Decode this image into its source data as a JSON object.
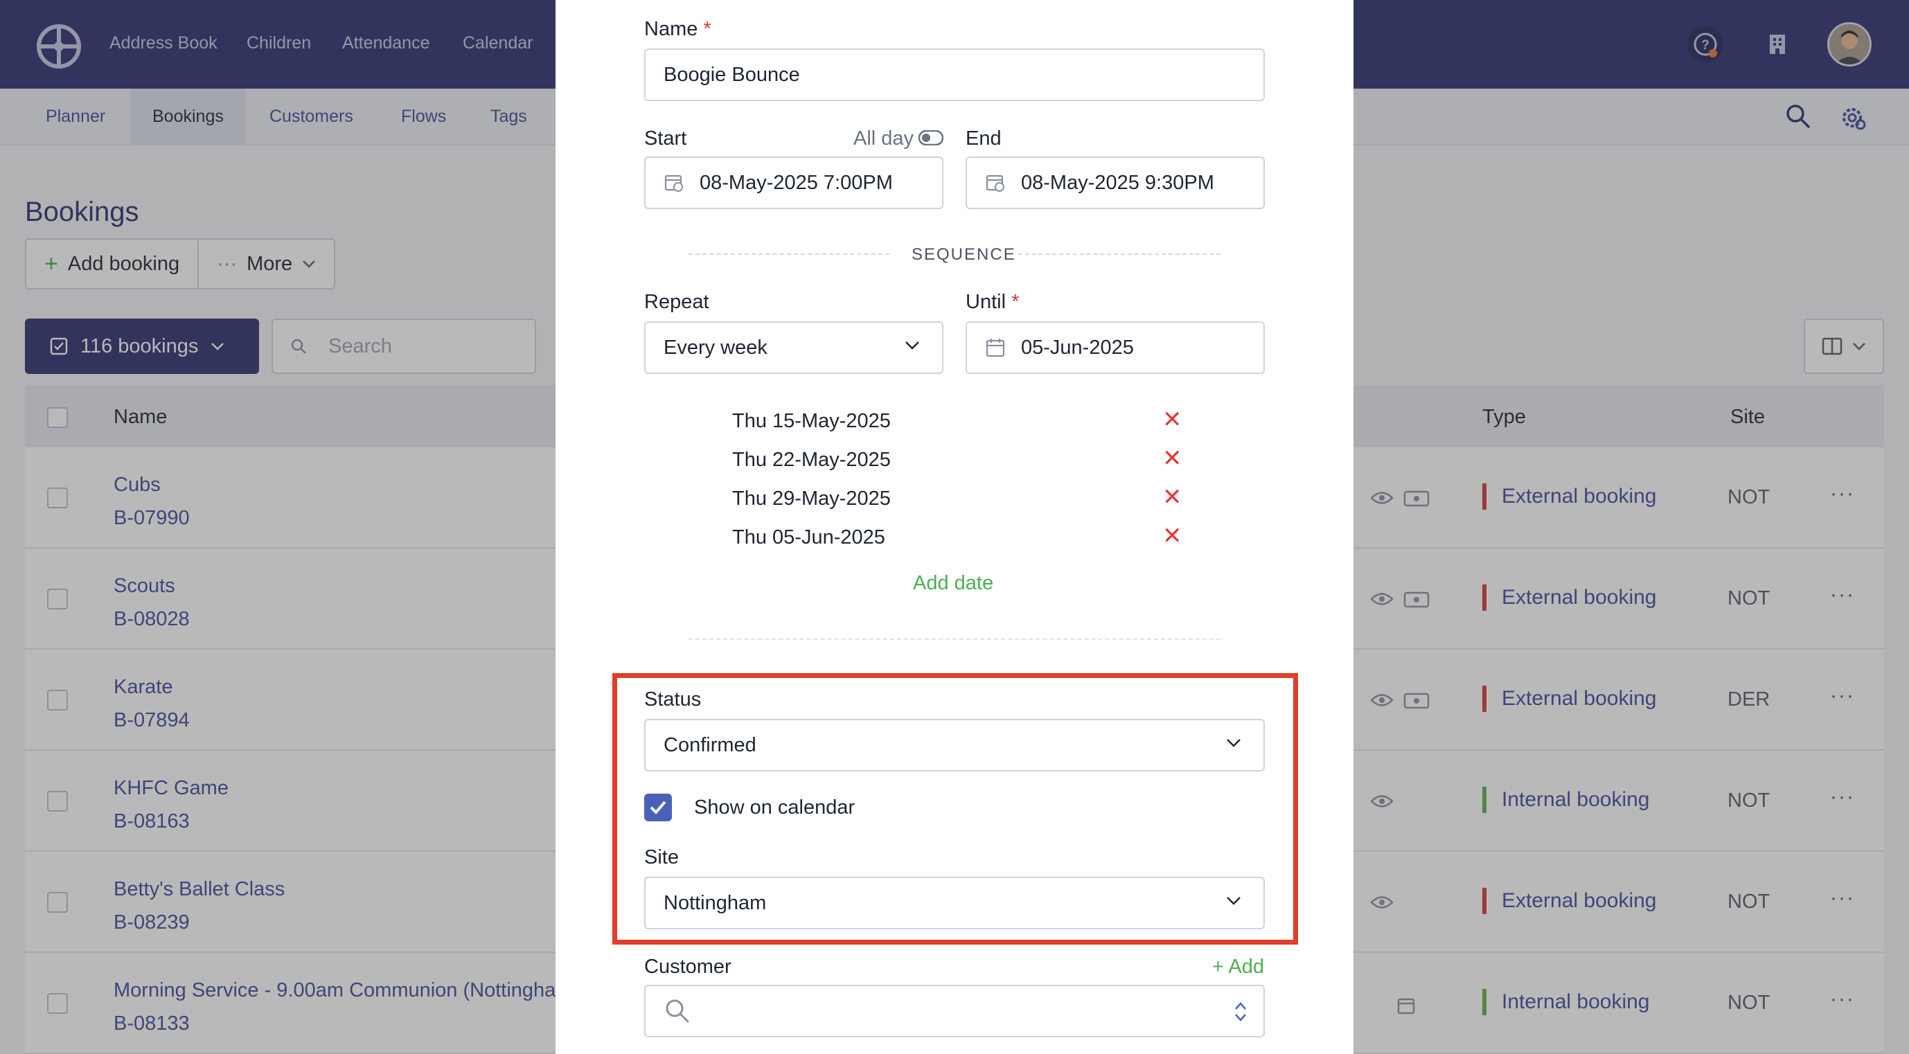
{
  "topnav": {
    "links": [
      "Address Book",
      "Children",
      "Attendance",
      "Calendar"
    ],
    "colors": {
      "bg": "#2c3070",
      "accent": "#4a61b8"
    }
  },
  "subnav": {
    "tabs": [
      "Planner",
      "Bookings",
      "Customers",
      "Flows",
      "Tags"
    ],
    "active_tab": "Bookings"
  },
  "page": {
    "title": "Bookings",
    "add_booking_label": "Add booking",
    "more_label": "More",
    "count_label": "116 bookings",
    "search_placeholder": "Search"
  },
  "table": {
    "headers": {
      "name": "Name",
      "type": "Type",
      "site": "Site"
    },
    "rows": [
      {
        "name": "Cubs",
        "ref": "B-07990",
        "type": "External booking",
        "site": "NOT"
      },
      {
        "name": "Scouts",
        "ref": "B-08028",
        "type": "External booking",
        "site": "NOT"
      },
      {
        "name": "Karate",
        "ref": "B-07894",
        "type": "External booking",
        "site": "DER"
      },
      {
        "name": "KHFC Game",
        "ref": "B-08163",
        "type": "Internal booking",
        "site": "NOT"
      },
      {
        "name": "Betty's Ballet Class",
        "ref": "B-08239",
        "type": "External booking",
        "site": "NOT"
      },
      {
        "name": "Morning Service - 9.00am Communion (Nottingha",
        "ref": "B-08133",
        "type": "Internal booking",
        "site": "NOT"
      }
    ]
  },
  "modal": {
    "name_label": "Name",
    "name_value": "Boogie Bounce",
    "start_label": "Start",
    "all_day_label": "All day",
    "start_value": "08-May-2025 7:00PM",
    "end_label": "End",
    "end_value": "08-May-2025 9:30PM",
    "sequence_title": "SEQUENCE",
    "repeat_label": "Repeat",
    "repeat_value": "Every week",
    "until_label": "Until",
    "until_value": "05-Jun-2025",
    "dates": [
      "Thu 15-May-2025",
      "Thu 22-May-2025",
      "Thu 29-May-2025",
      "Thu 05-Jun-2025"
    ],
    "add_date_label": "Add date",
    "status_label": "Status",
    "status_value": "Confirmed",
    "show_on_calendar_label": "Show on calendar",
    "show_on_calendar_checked": true,
    "site_label": "Site",
    "site_value": "Nottingham",
    "customer_label": "Customer",
    "add_customer_label": "+ Add",
    "required_mark": "*"
  }
}
